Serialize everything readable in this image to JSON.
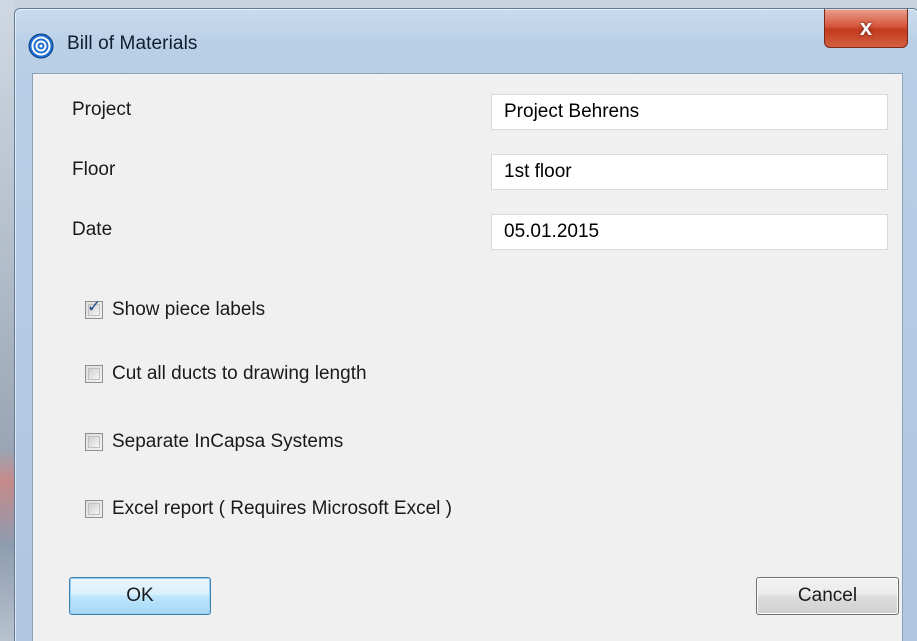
{
  "window": {
    "title": "Bill of Materials",
    "close_label": "x"
  },
  "form": {
    "project": {
      "label": "Project",
      "value": "Project Behrens"
    },
    "floor": {
      "label": "Floor",
      "value": "1st floor"
    },
    "date": {
      "label": "Date",
      "value": "05.01.2015"
    }
  },
  "options": [
    {
      "label": "Show piece labels",
      "checked": true
    },
    {
      "label": "Cut all ducts to drawing length",
      "checked": false
    },
    {
      "label": "Separate InCapsa Systems",
      "checked": false
    },
    {
      "label": "Excel report ( Requires Microsoft Excel )",
      "checked": false
    }
  ],
  "buttons": {
    "ok_label": "OK",
    "cancel_label": "Cancel"
  },
  "icons": {
    "app": "app-spiral-icon",
    "close": "close-icon",
    "check": "checkmark-icon"
  }
}
